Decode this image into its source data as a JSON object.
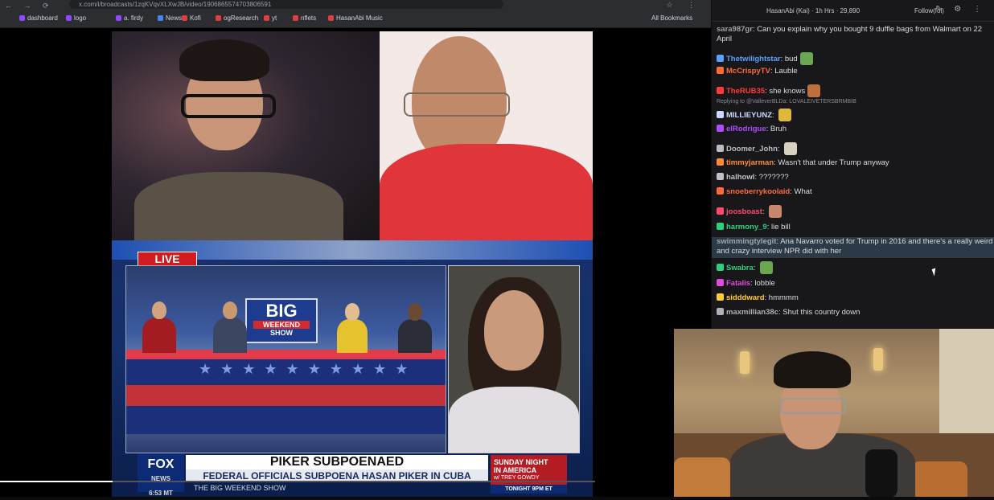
{
  "browser": {
    "url": "x.com/i/broadcasts/1zqKVqvXLXwJB/video/1906865574703806591",
    "nav_icons": "← → ⟳",
    "tool_icons": "☆ ⋮"
  },
  "bookmarks": {
    "items": [
      {
        "label": "dashboard",
        "color": "#9146ff"
      },
      {
        "label": "logo",
        "color": "#9146ff"
      },
      {
        "label": "a. firdy",
        "color": "#9146ff"
      },
      {
        "label": "News",
        "color": "#4285f4"
      },
      {
        "label": "Kofi",
        "color": "#e23c3c"
      },
      {
        "label": "ogResearch",
        "color": "#e23c3c"
      },
      {
        "label": "yt",
        "color": "#e23c3c"
      },
      {
        "label": "nflets",
        "color": "#e23c3c"
      },
      {
        "label": "HasanAbi Music",
        "color": "#e23c3c"
      }
    ],
    "all_bookmarks": "All Bookmarks"
  },
  "fox": {
    "live": "LIVE",
    "show_logo_big": "BIG",
    "show_logo_weekend": "WEEKEND",
    "show_logo_show": "SHOW",
    "network": "FOX",
    "network_sub": "NEWS",
    "clock": "6:53 MT",
    "headline": "PIKER SUBPOENAED",
    "subheadline": "FEDERAL OFFICIALS SUBPOENA HASAN PIKER IN CUBA PROBE",
    "ticker": "THE BIG WEEKEND SHOW",
    "promo_line1": "SUNDAY NIGHT",
    "promo_line2": "IN AMERICA",
    "promo_line3": "w/ TREY GOWDY",
    "promo_time": "TONIGHT 9PM ET"
  },
  "chat_header": {
    "title": "HasanAbi (Kai) · 1h Hrs · 29,890",
    "follow": "Follow(fol)",
    "icons": "✎ ⚙ ⋮"
  },
  "chat": {
    "messages": [
      {
        "user": "sara987gr",
        "user_color": "#a0a0a8",
        "text": "Can you explain why you bought 9 duffle bags from Walmart on 22 April"
      },
      {
        "user": "Thetwilightstar",
        "user_color": "#5aa0ff",
        "text": "bud"
      },
      {
        "user": "McCrispyTV",
        "user_color": "#ff6b35",
        "text": "Lauble"
      },
      {
        "user": "TheRUB35",
        "user_color": "#ff3a3a",
        "text": "she knows"
      },
      {
        "reply": "Replying to @ValleverBLDa: LOVALEIVETERSBRMBIB"
      },
      {
        "user": "MILLIEYUNZ",
        "user_color": "#cfd6ff",
        "text": ""
      },
      {
        "user": "elRodrigue",
        "user_color": "#b04bff",
        "text": "Bruh"
      },
      {
        "user": "Doomer_John",
        "user_color": "#bcbcc4",
        "text": ""
      },
      {
        "user": "timmyjarman",
        "user_color": "#ff8c3a",
        "text": "Wasn't that under Trump anyway"
      },
      {
        "user": "halhowl",
        "user_color": "#c0c0c8",
        "text": "???????"
      },
      {
        "user": "snoeberrykoolaid",
        "user_color": "#ff6a3a",
        "text": "What"
      },
      {
        "user": "joosboast",
        "user_color": "#ff4a6a",
        "text": ""
      },
      {
        "user": "harmony_9",
        "user_color": "#2ad17f",
        "text": "lie bill"
      },
      {
        "user": "swimmingtylegit",
        "user_color": "#9ea6ae",
        "text": "Ana Navarro voted for Trump in 2016 and there's a really weird and crazy interview NPR did with her",
        "highlight": true
      },
      {
        "user": "Swabra",
        "user_color": "#2ad17f",
        "text": ""
      },
      {
        "user": "Fatalis",
        "user_color": "#e04bd8",
        "text": "lobble"
      },
      {
        "user": "sidddward",
        "user_color": "#ffcc33",
        "text": "hmmmm"
      },
      {
        "user": "maxmillian38c",
        "user_color": "#b0b0b8",
        "text": "Shut this country down"
      }
    ]
  }
}
